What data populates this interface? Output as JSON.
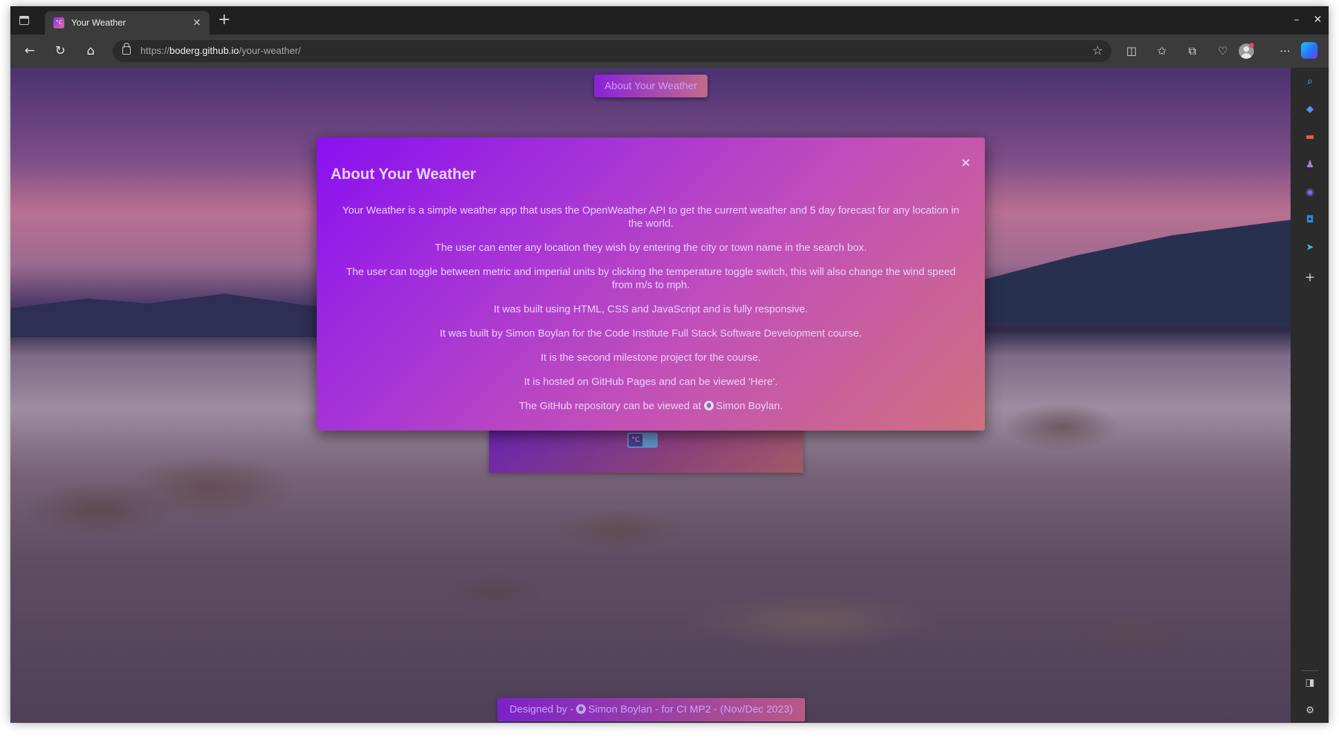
{
  "browser": {
    "tab_title": "Your Weather",
    "tab_favicon_text": "°C",
    "tab_close": "×",
    "new_tab": "+",
    "url_scheme": "https://",
    "url_host": "boderg.github.io",
    "url_path": "/your-weather/",
    "window_controls": {
      "minimize": "–",
      "close": "✕"
    },
    "toolbar_icons": [
      "back-icon",
      "refresh-icon",
      "home-icon",
      "favorite-star-icon",
      "split-screen-icon",
      "favorites-icon",
      "collections-icon",
      "browser-essentials-icon",
      "profile-icon",
      "more-icon",
      "copilot-icon"
    ],
    "sidebar_icons": [
      "search-icon",
      "shopping-icon",
      "tools-icon",
      "people-icon",
      "microsoft-365-icon",
      "outlook-icon",
      "drop-icon",
      "add-icon",
      "hide-sidebar-icon",
      "settings-icon"
    ]
  },
  "page": {
    "about_button_label": "About Your Weather",
    "unit_toggle_label": "°C",
    "footer": {
      "prefix": "Designed by - ",
      "author": "Simon Boylan",
      "suffix": " - for CI MP2 - (Nov/Dec 2023)"
    }
  },
  "modal": {
    "title": "About Your Weather",
    "close_label": "×",
    "paragraphs": [
      "Your Weather is a simple weather app that uses the OpenWeather API to get the current weather and 5 day forecast for any location in the world.",
      "The user can enter any location they wish by entering the city or town name in the search box.",
      "The user can toggle between metric and imperial units by clicking the temperature toggle switch, this will also change the wind speed from m/s to mph.",
      "It was built using HTML, CSS and JavaScript and is fully responsive.",
      "It was built by Simon Boylan for the Code Institute Full Stack Software Development course.",
      "It is the second milestone project for the course.",
      "It is hosted on GitHub Pages and can be viewed 'Here'."
    ],
    "repo_prefix": "The GitHub repository can be viewed at ",
    "repo_link": "Simon Boylan."
  },
  "colors": {
    "modal_start": "#8a10f0",
    "modal_end": "#d0707e",
    "text_lilac": "#e6d4ff",
    "browser_dark": "#202020"
  }
}
